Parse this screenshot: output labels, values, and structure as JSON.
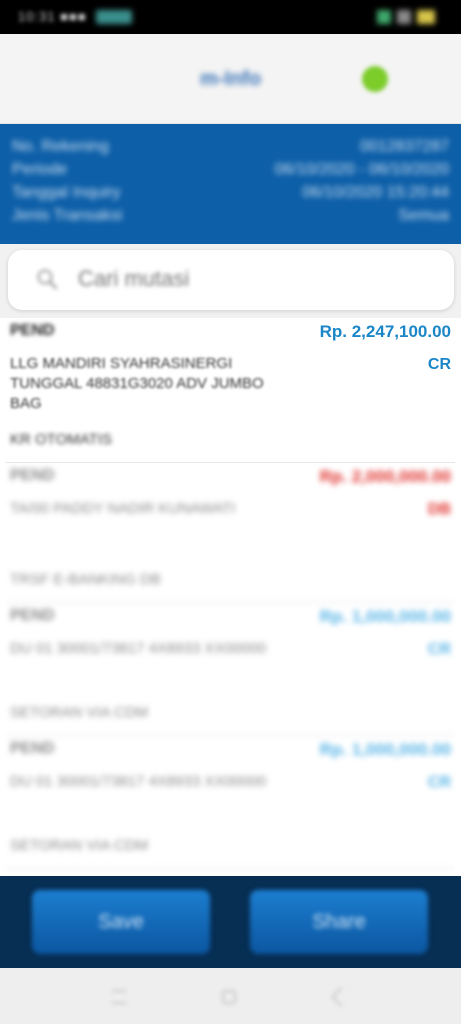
{
  "colors": {
    "primary": "#0d5fa8",
    "credit": "#1a86c8",
    "debit": "#e0312c",
    "online": "#7ccc2a"
  },
  "status_bar": {
    "time": "10:31 ■■■"
  },
  "header": {
    "title": "m-Info",
    "icon": "online-status-dot"
  },
  "info": {
    "rows": [
      {
        "label": "No. Rekening",
        "value": "0012837287"
      },
      {
        "label": "Periode",
        "value": "06/10/2020 - 06/10/2020"
      },
      {
        "label": "Tanggal Inquiry",
        "value": "06/10/2020 15:20:44"
      },
      {
        "label": "Jenis Transaksi",
        "value": "Semua"
      }
    ]
  },
  "search": {
    "placeholder": "Cari mutasi"
  },
  "transactions": [
    {
      "type": "PEND",
      "amount": "Rp. 2,247,100.00",
      "desc": "LLG MANDIRI SYAHRASINERGI TUNGGAL 48831G3020 ADV JUMBO BAG",
      "dc": "CR",
      "ref": "KR OTOMATIS"
    },
    {
      "type": "PEND",
      "amount": "Rp. 2,000,000.00",
      "desc": "TA/00 PADDY       NADIR KUNAWATI",
      "dc": "DB",
      "ref": "TRSF E-BANKING DB"
    },
    {
      "type": "PEND",
      "amount": "Rp. 1,000,000.00",
      "desc": "DU 01 30001/73817 4X8933 XX00000",
      "dc": "CR",
      "ref": "SETORAN VIA CDM"
    },
    {
      "type": "PEND",
      "amount": "Rp. 1,000,000.00",
      "desc": "DU 01 30001/73817 4X8933 XX00000",
      "dc": "CR",
      "ref": "SETORAN VIA CDM"
    }
  ],
  "actions": {
    "save_label": "Save",
    "share_label": "Share"
  }
}
